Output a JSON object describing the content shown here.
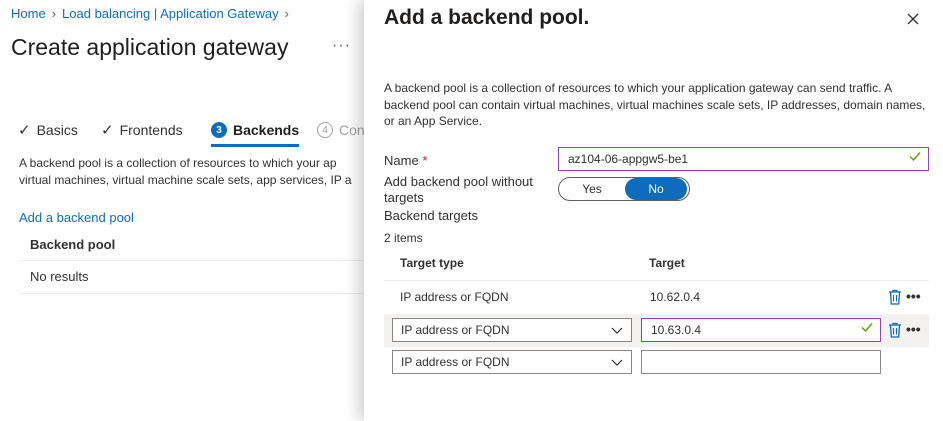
{
  "breadcrumb": [
    "Home",
    "Load balancing | Application Gateway"
  ],
  "page_title": "Create application gateway",
  "more_label": "···",
  "steps": [
    {
      "label": "Basics",
      "state": "done"
    },
    {
      "label": "Frontends",
      "state": "done"
    },
    {
      "label": "Backends",
      "state": "active",
      "num": "3"
    },
    {
      "label": "Con",
      "state": "disabled",
      "num": "4"
    }
  ],
  "left": {
    "desc_line1": "A backend pool is a collection of resources to which your ap",
    "desc_line2": "virtual machines, virtual machine scale sets, app services, IP a",
    "add_link": "Add a backend pool",
    "table_header": "Backend pool",
    "no_results": "No results"
  },
  "panel": {
    "title": "Add a backend pool.",
    "description": "A backend pool is a collection of resources to which your application gateway can send traffic. A backend pool can contain virtual machines, virtual machines scale sets, IP addresses, domain names, or an App Service.",
    "name_label": "Name",
    "required_mark": "*",
    "name_value": "az104-06-appgw5-be1",
    "without_targets_label": "Add backend pool without targets",
    "toggle_yes": "Yes",
    "toggle_no": "No",
    "toggle_selected": "No",
    "backend_targets_label": "Backend targets",
    "item_count": "2 items",
    "col_target_type": "Target type",
    "col_target": "Target",
    "rows": [
      {
        "type": "IP address or FQDN",
        "target": "10.62.0.4"
      },
      {
        "type": "IP address or FQDN",
        "target": "10.63.0.4"
      },
      {
        "type": "IP address or FQDN",
        "target": ""
      }
    ],
    "more_label": "•••"
  },
  "colors": {
    "accent": "#0f6cbd",
    "valid": "#57a300",
    "focus_border": "#8e44ad"
  }
}
